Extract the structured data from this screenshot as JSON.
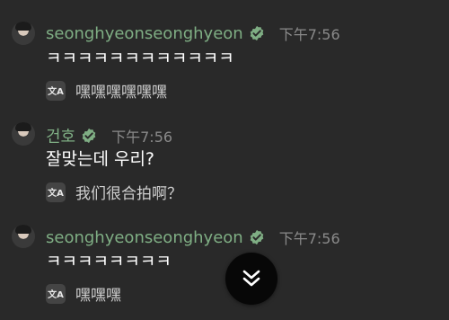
{
  "colors": {
    "background": "#292929",
    "username": "#7fae84",
    "verified": "#7fae84",
    "timestamp": "#8a8a8a",
    "translation_text": "#cfcfcf"
  },
  "messages": [
    {
      "username": "seonghyeonseonghyeon",
      "time": "下午7:56",
      "text": "ㅋㅋㅋㅋㅋㅋㅋㅋㅋㅋㅋㅋ",
      "translation": "嘿嘿嘿嘿嘿嘿",
      "translate_icon": "文A"
    },
    {
      "username": "건호",
      "time": "下午7:56",
      "text": "잘맞는데 우리?",
      "translation": "我们很合拍啊？",
      "translate_icon": "文A"
    },
    {
      "username": "seonghyeonseonghyeon",
      "time": "下午7:56",
      "text": "ㅋㅋㅋㅋㅋㅋㅋㅋ",
      "translation": "嘿嘿嘿",
      "translate_icon": "文A"
    }
  ],
  "scroll_button_icon": "double-chevron-down-icon"
}
